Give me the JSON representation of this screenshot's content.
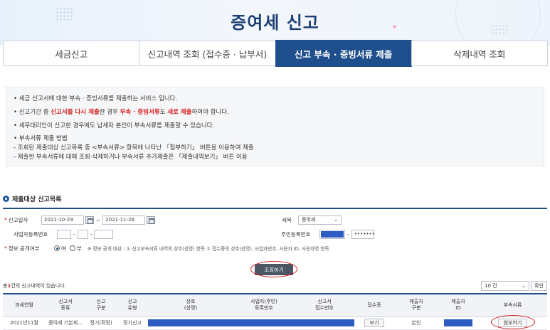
{
  "page": {
    "title": "증여세 신고"
  },
  "tabs": [
    {
      "label": "세금신고"
    },
    {
      "label": "신고내역 조회 (접수증 · 납부서)"
    },
    {
      "label": "신고 부속 · 증빙서류 제출"
    },
    {
      "label": "삭제내역 조회"
    }
  ],
  "info": {
    "l1": "• 세금 신고서에 대한 부속 · 증빙서류를 제출하는 서비스 입니다.",
    "l2a": "• 신고기간 중 ",
    "l2b": "신고서를 다시 제출",
    "l2c": "한 경우 ",
    "l2d": "부속 · 증빙서류",
    "l2e": "도 ",
    "l2f": "새로 제출",
    "l2g": "하여야 합니다.",
    "l3": "• 세무대리인이 신고한 경우에도 납세자 본인이 부속서류를 제출할 수 있습니다.",
    "l4": "• 부속서류 제출 방법",
    "l5": " - 조회된 제출대상 신고목록 중 <부속서류> 항목에 나타난 「첨부하기」 버튼을 이용하여 제출",
    "l6": " - 제출한 부속서류에 대해 조회·삭제하거나 부속서류 추가제출은 「제출내역보기」 버튼 이용"
  },
  "section": {
    "title": "제출대상 신고목록"
  },
  "form": {
    "date_label": "신고일자",
    "date_from": "2021-10-29",
    "date_to": "2021-11-28",
    "tilde": "~",
    "tax_label": "세목",
    "tax_value": "증여세",
    "bizno_label": "사업자등록번호",
    "resno_label": "주민등록번호",
    "resno_suffix": "•••••••",
    "dash": "-",
    "open_label": "정보 공개여부",
    "yes": "여",
    "no": "부",
    "open_note": "※ 정보 공개 대상 : ① 신고부속서류 내역의 상호(성명) 항목 ② 접수증의 상호(성명), 사업자번호, 사용자 ID, 사용자명 항목"
  },
  "search_button": "조회하기",
  "results": {
    "count_prefix": "총",
    "count": "1",
    "count_suffix": "건의 신고내역이 있습니다.",
    "page_size": "10 건",
    "ok": "확인"
  },
  "table": {
    "headers": [
      "과세연월",
      "신고서\n종류",
      "신고\n구분",
      "신고\n유형",
      "상호\n(성명)",
      "사업자(주민)\n등록번호",
      "신고서\n접수번호",
      "접수증",
      "제출자\n구분",
      "제출자\nID",
      "부속서류"
    ],
    "row": {
      "period": "2021년11월",
      "kind": "증여세 기본세...",
      "division": "정기(확정)",
      "type": "정기신고",
      "receipt_btn": "보기",
      "submitter": "본인",
      "attach_btn": "첨부하기"
    }
  },
  "colors": {
    "primary": "#1f4e8c",
    "highlight": "#d42020",
    "mask": "#2d5cc2"
  }
}
